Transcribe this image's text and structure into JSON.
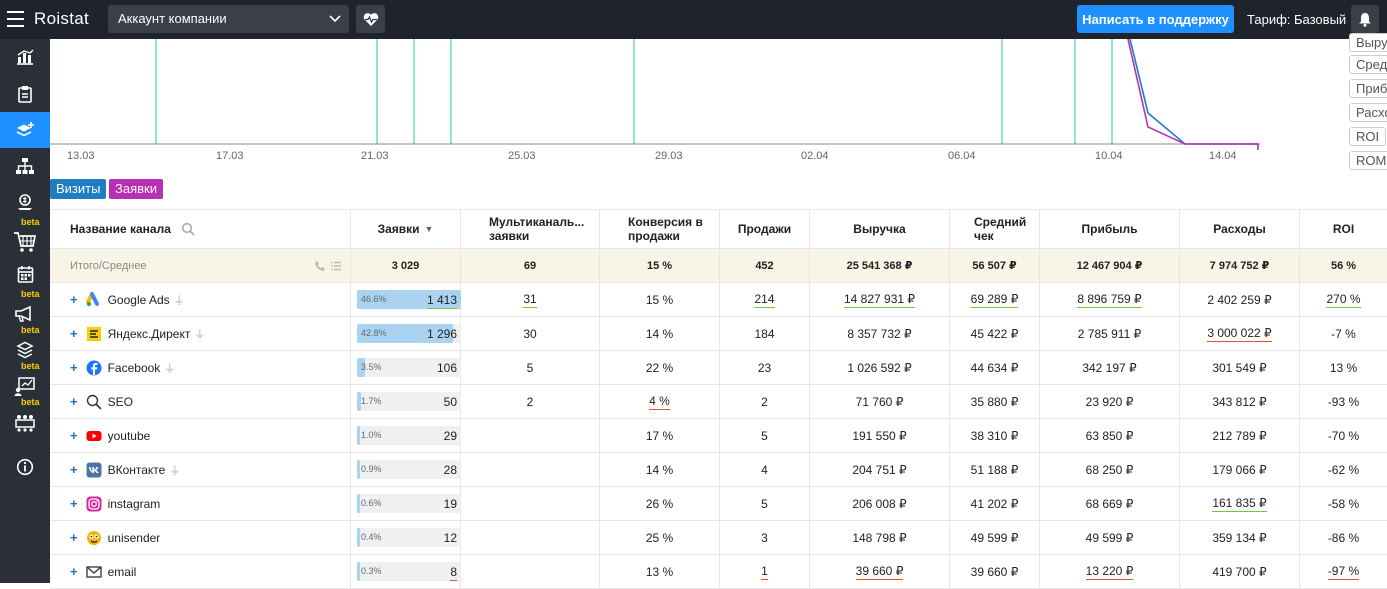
{
  "header": {
    "logo": "Roistat",
    "account": "Аккаунт компании",
    "support_button": "Написать в поддержку",
    "tariff": "Тариф: Базовый"
  },
  "sidebar": {
    "active_index": 2,
    "beta_label": "beta"
  },
  "chart": {
    "x_ticks": [
      "13.03",
      "17.03",
      "21.03",
      "25.03",
      "29.03",
      "02.04",
      "06.04",
      "10.04",
      "14.04"
    ],
    "metric_buttons": [
      "Выручка",
      "Средний чек",
      "Прибыль",
      "Расходы",
      "ROI",
      "ROMI"
    ],
    "series_tags": [
      "Визиты",
      "Заявки"
    ],
    "colors": {
      "visits": "#1f7ec2",
      "leads": "#b82fb5",
      "gridline": "#27c7a4"
    }
  },
  "table": {
    "headers": {
      "channel": "Название канала",
      "leads": "Заявки",
      "multichannel": "Мультиканаль... заявки",
      "conversion": "Конверсия в продажи",
      "sales": "Продажи",
      "revenue": "Выручка",
      "avg_check": "Средний чек",
      "profit": "Прибыль",
      "expenses": "Расходы",
      "roi": "ROI"
    },
    "total": {
      "label": "Итого/Среднее",
      "leads": "3 029",
      "multichannel": "69",
      "conversion": "15 %",
      "sales": "452",
      "revenue": "25 541 368 ₽",
      "avg_check": "56 507 ₽",
      "profit": "12 467 904 ₽",
      "expenses": "7 974 752 ₽",
      "roi": "56 %"
    },
    "rows": [
      {
        "name": "Google Ads",
        "icon": "google-ads-icon",
        "plug": true,
        "share": "46.6%",
        "share_value": 0.466,
        "leads": "1 413",
        "multichannel": "31",
        "conversion": "15 %",
        "sales": "214",
        "revenue": "14 827 931 ₽",
        "avg_check": "69 289 ₽",
        "profit": "8 896 759 ₽",
        "expenses": "2 402 259 ₽",
        "roi": "270 %"
      },
      {
        "name": "Яндекс.Директ",
        "icon": "yandex-direct-icon",
        "plug": true,
        "share": "42.8%",
        "share_value": 0.428,
        "leads": "1 296",
        "multichannel": "30",
        "conversion": "14 %",
        "sales": "184",
        "revenue": "8 357 732 ₽",
        "avg_check": "45 422 ₽",
        "profit": "2 785 911 ₽",
        "expenses": "3 000 022 ₽",
        "roi": "-7 %"
      },
      {
        "name": "Facebook",
        "icon": "facebook-icon",
        "plug": true,
        "share": "3.5%",
        "share_value": 0.035,
        "leads": "106",
        "multichannel": "5",
        "conversion": "22 %",
        "sales": "23",
        "revenue": "1 026 592 ₽",
        "avg_check": "44 634 ₽",
        "profit": "342 197 ₽",
        "expenses": "301 549 ₽",
        "roi": "13 %"
      },
      {
        "name": "SEO",
        "icon": "seo-icon",
        "plug": false,
        "share": "1.7%",
        "share_value": 0.017,
        "leads": "50",
        "multichannel": "2",
        "conversion": "4 %",
        "sales": "2",
        "revenue": "71 760 ₽",
        "avg_check": "35 880 ₽",
        "profit": "23 920 ₽",
        "expenses": "343 812 ₽",
        "roi": "-93 %"
      },
      {
        "name": "youtube",
        "icon": "youtube-icon",
        "plug": false,
        "share": "1.0%",
        "share_value": 0.01,
        "leads": "29",
        "multichannel": "",
        "conversion": "17 %",
        "sales": "5",
        "revenue": "191 550 ₽",
        "avg_check": "38 310 ₽",
        "profit": "63 850 ₽",
        "expenses": "212 789 ₽",
        "roi": "-70 %"
      },
      {
        "name": "ВКонтакте",
        "icon": "vk-icon",
        "plug": true,
        "share": "0.9%",
        "share_value": 0.009,
        "leads": "28",
        "multichannel": "",
        "conversion": "14 %",
        "sales": "4",
        "revenue": "204 751 ₽",
        "avg_check": "51 188 ₽",
        "profit": "68 250 ₽",
        "expenses": "179 066 ₽",
        "roi": "-62 %"
      },
      {
        "name": "instagram",
        "icon": "instagram-icon",
        "plug": false,
        "share": "0.6%",
        "share_value": 0.006,
        "leads": "19",
        "multichannel": "",
        "conversion": "26 %",
        "sales": "5",
        "revenue": "206 008 ₽",
        "avg_check": "41 202 ₽",
        "profit": "68 669 ₽",
        "expenses": "161 835 ₽",
        "roi": "-58 %"
      },
      {
        "name": "unisender",
        "icon": "unisender-icon",
        "plug": false,
        "share": "0.4%",
        "share_value": 0.004,
        "leads": "12",
        "multichannel": "",
        "conversion": "25 %",
        "sales": "3",
        "revenue": "148 798 ₽",
        "avg_check": "49 599 ₽",
        "profit": "49 599 ₽",
        "expenses": "359 134 ₽",
        "roi": "-86 %"
      },
      {
        "name": "email",
        "icon": "email-icon",
        "plug": false,
        "share": "0.3%",
        "share_value": 0.003,
        "leads": "8",
        "multichannel": "",
        "conversion": "13 %",
        "sales": "1",
        "revenue": "39 660 ₽",
        "avg_check": "39 660 ₽",
        "profit": "13 220 ₽",
        "expenses": "419 700 ₽",
        "roi": "-97 %"
      }
    ]
  }
}
